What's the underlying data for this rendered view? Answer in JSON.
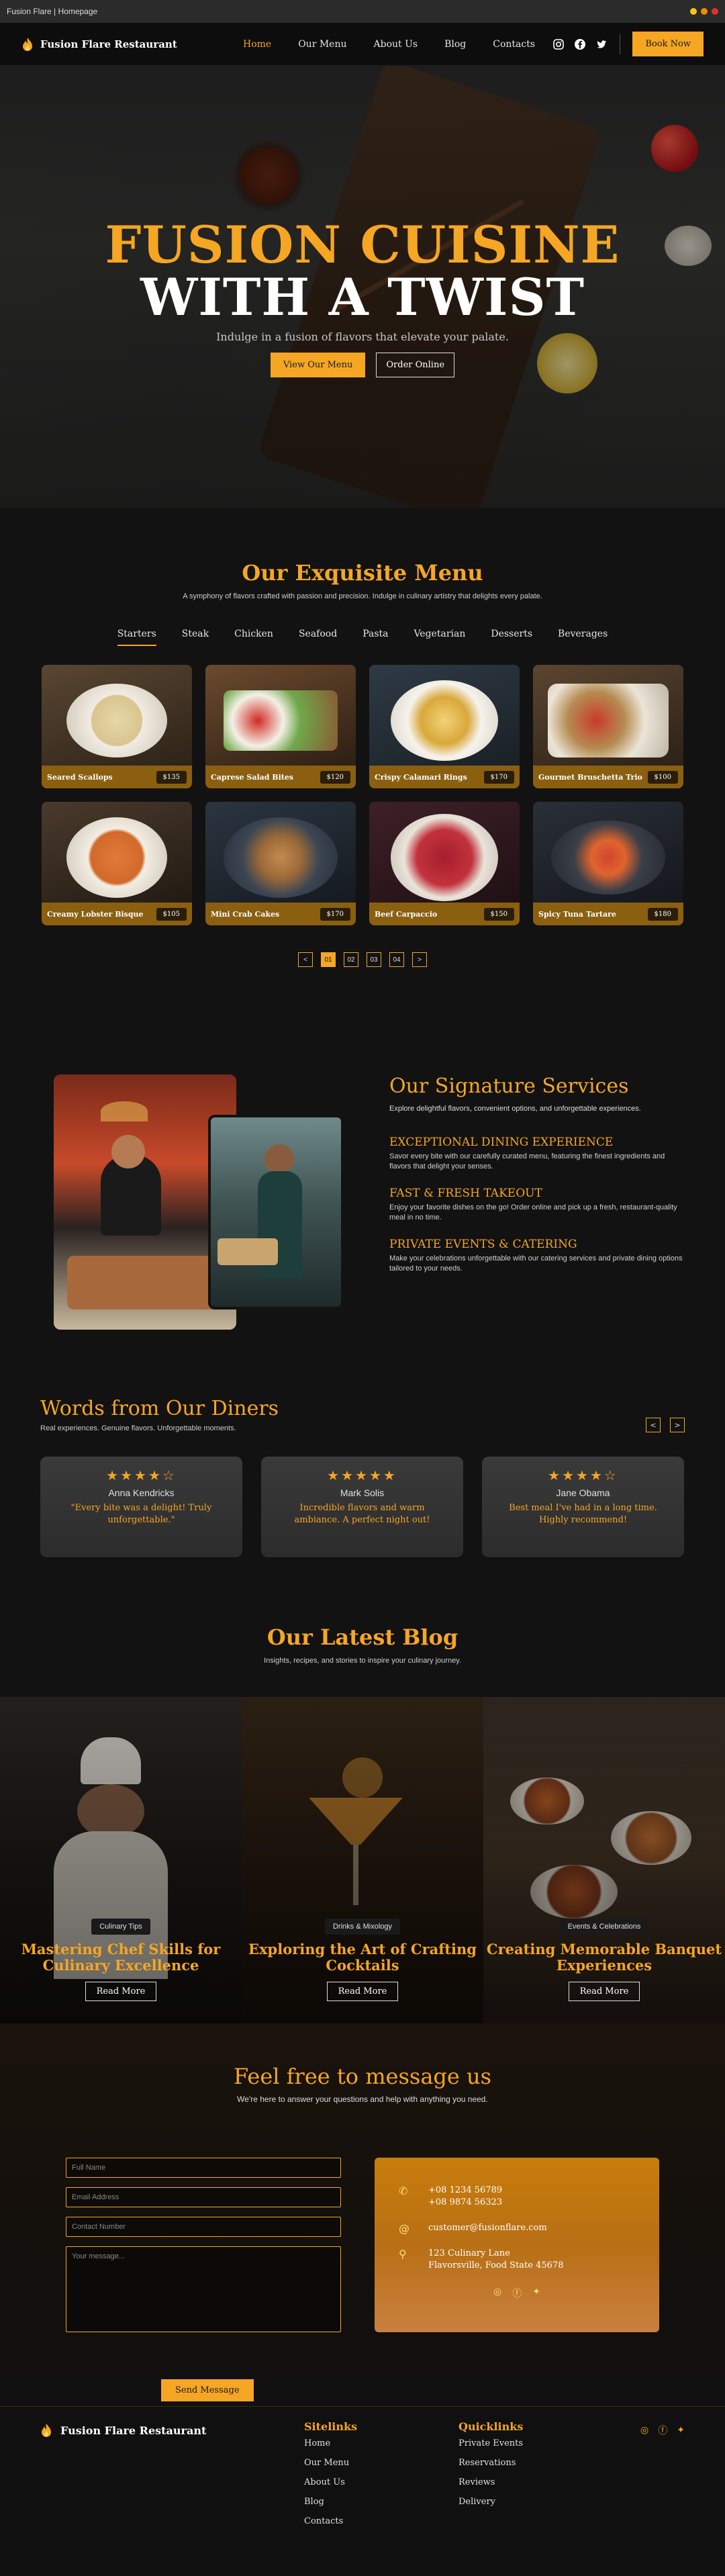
{
  "window": {
    "title": "Fusion Flare | Homepage",
    "dot_colors": [
      "#f5c518",
      "#f08c00",
      "#e03131"
    ]
  },
  "brand": {
    "name": "Fusion Flare Restaurant",
    "accent": "#f5a623"
  },
  "nav": {
    "items": [
      "Home",
      "Our Menu",
      "About Us",
      "Blog",
      "Contacts"
    ],
    "active": "Home",
    "social_icons": [
      "instagram-icon",
      "facebook-icon",
      "twitter-icon"
    ],
    "book_label": "Book Now"
  },
  "hero": {
    "title_line1": "FUSION CUISINE",
    "title_line2": "WITH A TWIST",
    "subtitle": "Indulge in a fusion of flavors that elevate your palate.",
    "primary_cta": "View Our Menu",
    "secondary_cta": "Order Online"
  },
  "menu": {
    "title": "Our Exquisite Menu",
    "subtitle": "A symphony of flavors crafted with passion and precision. Indulge in culinary artistry that delights every palate.",
    "tabs": [
      "Starters",
      "Steak",
      "Chicken",
      "Seafood",
      "Pasta",
      "Vegetarian",
      "Desserts",
      "Beverages"
    ],
    "active_tab": "Starters",
    "items": [
      {
        "name": "Seared Scallops",
        "price": "$135"
      },
      {
        "name": "Caprese Salad Bites",
        "price": "$120"
      },
      {
        "name": "Crispy Calamari Rings",
        "price": "$170"
      },
      {
        "name": "Gourmet Bruschetta Trio",
        "price": "$100"
      },
      {
        "name": "Creamy Lobster Bisque",
        "price": "$105"
      },
      {
        "name": "Mini Crab Cakes",
        "price": "$170"
      },
      {
        "name": "Beef Carpaccio",
        "price": "$150"
      },
      {
        "name": "Spicy Tuna Tartare",
        "price": "$180"
      }
    ],
    "pager": {
      "prev": "<",
      "pages": [
        "01",
        "02",
        "03",
        "04"
      ],
      "active": "01",
      "next": ">"
    }
  },
  "services": {
    "title": "Our Signature Services",
    "intro": "Explore delightful flavors, convenient options, and unforgettable experiences.",
    "items": [
      {
        "title": "EXCEPTIONAL DINING EXPERIENCE",
        "text": "Savor every bite with our carefully curated menu, featuring the finest ingredients and flavors that delight your senses."
      },
      {
        "title": "FAST & FRESH TAKEOUT",
        "text": "Enjoy your favorite dishes on the go! Order online and pick up a fresh, restaurant-quality meal in no time."
      },
      {
        "title": "PRIVATE EVENTS & CATERING",
        "text": "Make your celebrations unforgettable with our catering services and private dining options tailored to your needs."
      }
    ]
  },
  "reviews": {
    "title": "Words from Our Diners",
    "subtitle": "Real experiences. Genuine flavors. Unforgettable moments.",
    "prev": "<",
    "next": ">",
    "items": [
      {
        "stars": "★★★★☆",
        "name": "Anna Kendricks",
        "quote": "\"Every bite was a delight! Truly unforgettable.\""
      },
      {
        "stars": "★★★★★",
        "name": "Mark Solis",
        "quote": "Incredible flavors and warm ambiance. A perfect night out!"
      },
      {
        "stars": "★★★★☆",
        "name": "Jane Obama",
        "quote": "Best meal I've had in a long time. Highly recommend!"
      }
    ]
  },
  "blog": {
    "title": "Our Latest Blog",
    "subtitle": "Insights, recipes, and stories to inspire your culinary journey.",
    "read_more": "Read More",
    "posts": [
      {
        "tag": "Culinary Tips",
        "title": "Mastering Chef Skills for Culinary Excellence"
      },
      {
        "tag": "Drinks & Mixology",
        "title": "Exploring the Art of Crafting Cocktails"
      },
      {
        "tag": "Events & Celebrations",
        "title": "Creating Memorable Banquet Experiences"
      }
    ]
  },
  "contact": {
    "title": "Feel free to message us",
    "subtitle": "We're here to answer your questions and help with anything you need.",
    "placeholders": {
      "name": "Full Name",
      "email": "Email Address",
      "phone": "Contact Number",
      "message": "Your message..."
    },
    "send_label": "Send Message",
    "phone1": "+08 1234 56789",
    "phone2": "+08 9874 56323",
    "email": "customer@fusionflare.com",
    "address1": "123 Culinary Lane",
    "address2": "Flavorsville, Food State 45678"
  },
  "footer": {
    "brand": "Fusion Flare Restaurant",
    "sitelinks_title": "Sitelinks",
    "sitelinks": [
      "Home",
      "Our Menu",
      "About Us",
      "Blog",
      "Contacts"
    ],
    "quicklinks_title": "Quicklinks",
    "quicklinks": [
      "Private Events",
      "Reservations",
      "Reviews",
      "Delivery"
    ]
  }
}
